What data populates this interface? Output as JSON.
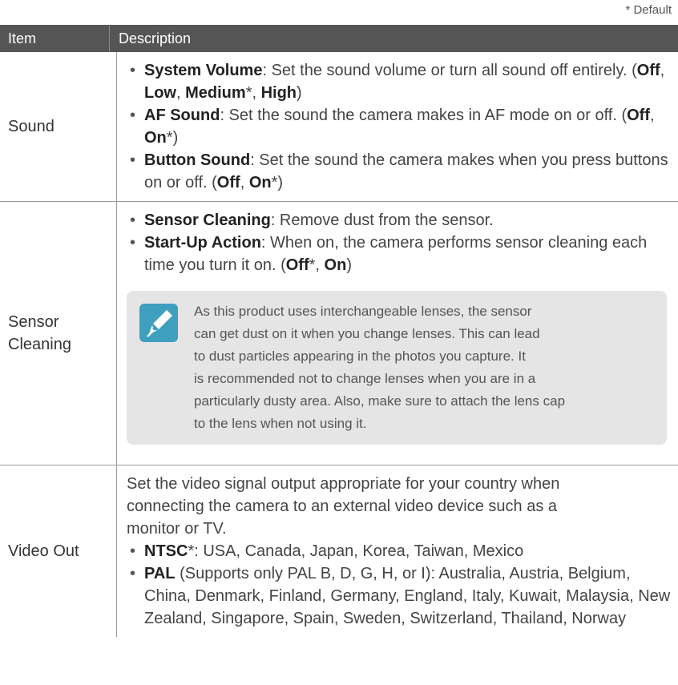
{
  "default_note": "* Default",
  "header": {
    "item": "Item",
    "description": "Description"
  },
  "rows": [
    {
      "item_lines": [
        "Sound"
      ],
      "bullets": [
        [
          {
            "t": "System Volume",
            "b": true
          },
          {
            "t": ": Set the sound volume or turn all sound off entirely. (",
            "b": false
          },
          {
            "t": "Off",
            "b": true
          },
          {
            "t": ", ",
            "b": false
          },
          {
            "t": "Low",
            "b": true
          },
          {
            "t": ", ",
            "b": false
          },
          {
            "t": "Medium",
            "b": true
          },
          {
            "t": "*, ",
            "b": false
          },
          {
            "t": "High",
            "b": true
          },
          {
            "t": ")",
            "b": false
          }
        ],
        [
          {
            "t": "AF Sound",
            "b": true
          },
          {
            "t": ": Set the sound the camera makes in AF mode on or off. (",
            "b": false
          },
          {
            "t": "Off",
            "b": true
          },
          {
            "t": ", ",
            "b": false
          },
          {
            "t": "On",
            "b": true
          },
          {
            "t": "*)",
            "b": false
          }
        ],
        [
          {
            "t": "Button Sound",
            "b": true
          },
          {
            "t": ": Set the sound the camera makes when you press buttons on or off. (",
            "b": false
          },
          {
            "t": "Off",
            "b": true
          },
          {
            "t": ", ",
            "b": false
          },
          {
            "t": "On",
            "b": true
          },
          {
            "t": "*)",
            "b": false
          }
        ]
      ]
    },
    {
      "item_lines": [
        "Sensor",
        "Cleaning"
      ],
      "bullets": [
        [
          {
            "t": "Sensor Cleaning",
            "b": true
          },
          {
            "t": ": Remove dust from the sensor.",
            "b": false
          }
        ],
        [
          {
            "t": "Start-Up Action",
            "b": true
          },
          {
            "t": ": When on, the camera performs sensor cleaning each time you turn it on. (",
            "b": false
          },
          {
            "t": "Off",
            "b": true
          },
          {
            "t": "*, ",
            "b": false
          },
          {
            "t": "On",
            "b": true
          },
          {
            "t": ")",
            "b": false
          }
        ]
      ],
      "note": {
        "icon": "pen-note-icon",
        "icon_color": "#3f9fbf",
        "lines": [
          "As this product uses interchangeable lenses, the sensor",
          "can get dust on it when you change lenses. This can lead",
          "to dust particles appearing in the photos you capture. It",
          "is recommended not to change lenses when you are in a",
          "particularly dusty area. Also, make sure to attach the lens cap",
          "to the lens when not using it."
        ]
      }
    },
    {
      "item_lines": [
        "Video Out"
      ],
      "intro_lines": [
        "Set the video signal output appropriate for your country when",
        "connecting the camera to an external video device such as a",
        "monitor or TV."
      ],
      "bullets": [
        [
          {
            "t": "NTSC",
            "b": true
          },
          {
            "t": "*: USA, Canada, Japan, Korea, Taiwan, Mexico",
            "b": false
          }
        ],
        [
          {
            "t": "PAL",
            "b": true
          },
          {
            "t": " (Supports only PAL B, D, G, H, or I): Australia, Austria, Belgium, China, Denmark, Finland, Germany, England, Italy, Kuwait, Malaysia, New Zealand, Singapore, Spain, Sweden, Switzerland, Thailand, Norway",
            "b": false
          }
        ]
      ]
    }
  ]
}
